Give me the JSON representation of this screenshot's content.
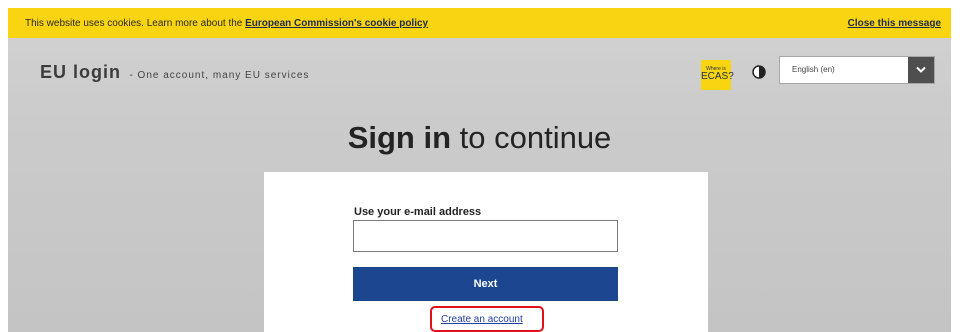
{
  "cookie_banner": {
    "text": "This website uses cookies. Learn more about the ",
    "policy_link": "European Commission's cookie policy",
    "close_label": "Close this message"
  },
  "header": {
    "brand_name": "EU login",
    "brand_tagline": "- One account, many EU services",
    "ecas_badge_small": "Where is",
    "ecas_badge": "ECAS?",
    "contrast_icon": "contrast-icon",
    "language_selected": "English (en)"
  },
  "main": {
    "heading_bold": "Sign in",
    "heading_rest": " to continue",
    "email_label": "Use your e-mail address",
    "email_value": "",
    "next_label": "Next",
    "create_account_label": "Create an account"
  },
  "colors": {
    "banner": "#f9d411",
    "primary_button": "#1d4691",
    "highlight": "#e0111b"
  }
}
